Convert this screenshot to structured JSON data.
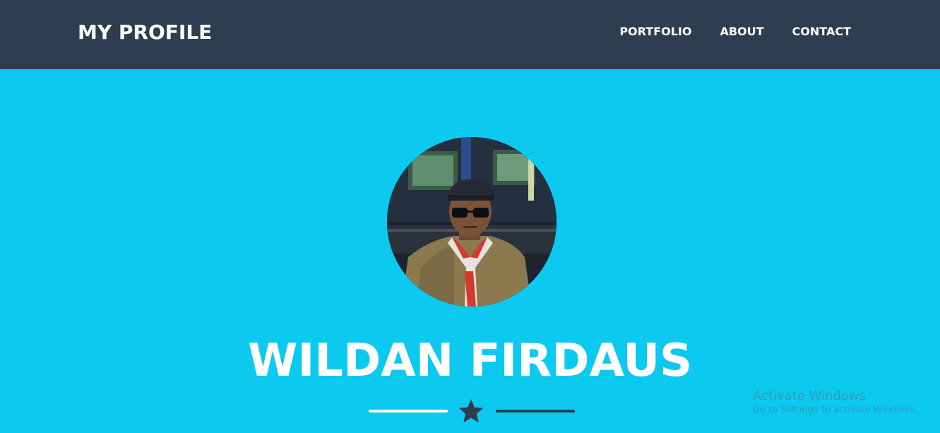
{
  "navbar": {
    "brand": "MY PROFILE",
    "links": [
      {
        "label": "PORTFOLIO"
      },
      {
        "label": "ABOUT"
      },
      {
        "label": "CONTACT"
      }
    ]
  },
  "hero": {
    "name": "WILDAN FIRDAUS",
    "divider_icon": "star-icon",
    "avatar_description": "profile-photo"
  },
  "watermark": {
    "title": "Activate Windows",
    "subtitle": "Go to Settings to activate Windows."
  },
  "colors": {
    "navbar_bg": "#2c3e50",
    "hero_bg": "#0cc9f0",
    "text": "#ffffff",
    "divider_dark": "#2c3e50"
  }
}
